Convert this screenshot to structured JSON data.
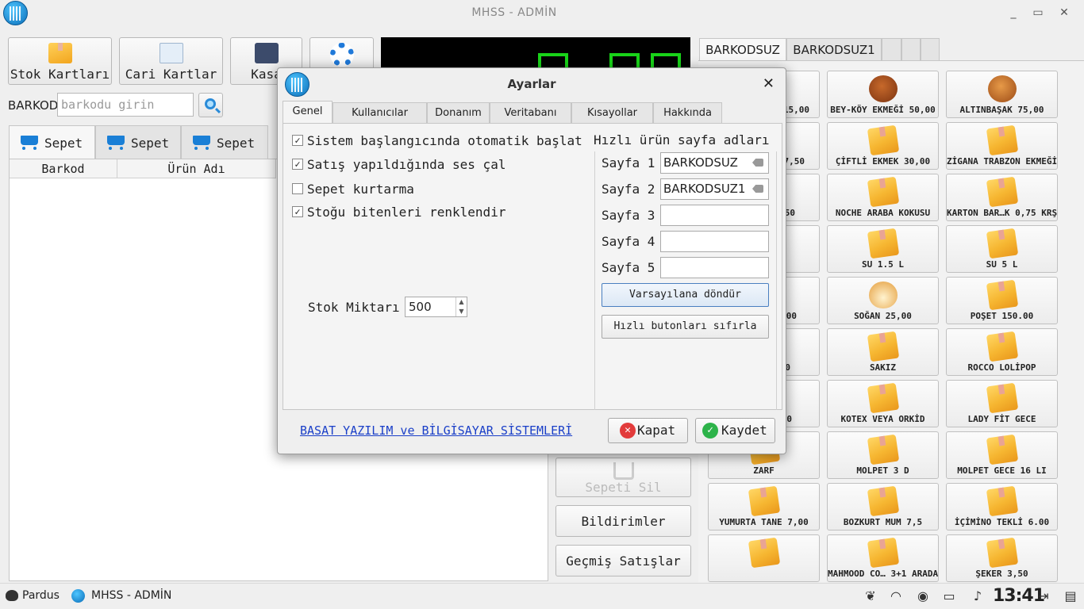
{
  "window": {
    "title": "MHSS - ADMİN"
  },
  "toolbar": {
    "stok_label": "Stok Kartları",
    "cari_label": "Cari Kartlar",
    "kasa_label": "Kasa"
  },
  "barcode": {
    "label": "BARKOD",
    "placeholder": "barkodu girin"
  },
  "cart_tabs": [
    "Sepet",
    "Sepet",
    "Sepet"
  ],
  "cart_table": {
    "columns": [
      "Barkod",
      "Ürün Adı"
    ]
  },
  "side_buttons": {
    "sepeti_sil": "Sepeti Sil",
    "bildirimler": "Bildirimler",
    "gecmis": "Geçmiş Satışlar"
  },
  "product_tabs": [
    "BARKODSUZ",
    "BARKODSUZ1"
  ],
  "products": {
    "col0": [
      "15,00",
      "7,50",
      "50",
      "",
      "00",
      "0",
      "00",
      "ZARF",
      "YUMURTA TANE 7,00",
      ""
    ],
    "col1": [
      "BEY-KÖY EKMEĞİ 50,00",
      "ÇİFTLİ EKMEK 30,00",
      "NOCHE ARABA KOKUSU",
      "SU 1.5 L",
      "SOĞAN 25,00",
      "SAKIZ",
      "KOTEX VEYA ORKİD",
      "MOLPET 3 D",
      "BOZKURT MUM 7,5",
      "MAHMOOD CO… 3+1 ARADA"
    ],
    "col2": [
      "ALTINBAŞAK 75,00",
      "ZİGANA TRABZON EKMEĞİ",
      "KARTON BAR…K 0,75 KRŞ",
      "SU 5 L",
      "POŞET 150.00",
      "ROCCO LOLİPOP",
      "LADY FİT GECE",
      "MOLPET GECE 16 LI",
      "İÇİMİNO TEKLİ 6.00",
      "ŞEKER 3,50"
    ]
  },
  "dialog": {
    "title": "Ayarlar",
    "tabs": [
      "Genel",
      "Kullanıcılar",
      "Donanım",
      "Veritabanı",
      "Kısayollar",
      "Hakkında"
    ],
    "options": {
      "auto_start": {
        "label": "Sistem başlangıcında otomatik başlat",
        "checked": true,
        "mark": "✓"
      },
      "sound": {
        "label": "Satış yapıldığında ses çal",
        "checked": true,
        "mark": "✓"
      },
      "recover": {
        "label": "Sepet kurtarma",
        "checked": false,
        "mark": ""
      },
      "color_out": {
        "label": "Stoğu bitenleri renklendir",
        "checked": true,
        "mark": "✓"
      }
    },
    "stock_label": "Stok Miktarı",
    "stock_value": "500",
    "pages_heading": "Hızlı ürün sayfa adları",
    "pages": [
      {
        "label": "Sayfa 1",
        "value": "BARKODSUZ"
      },
      {
        "label": "Sayfa 2",
        "value": "BARKODSUZ1"
      },
      {
        "label": "Sayfa 3",
        "value": ""
      },
      {
        "label": "Sayfa 4",
        "value": ""
      },
      {
        "label": "Sayfa 5",
        "value": ""
      }
    ],
    "reset_names_btn": "Varsayılana döndür",
    "reset_buttons_btn": "Hızlı butonları sıfırla",
    "company_link": "BASAT YAZILIM ve BİLGİSAYAR SİSTEMLERİ",
    "close_btn": "Kapat",
    "save_btn": "Kaydet"
  },
  "taskbar": {
    "start_label": "Pardus",
    "app_label": "MHSS - ADMİN",
    "clock": "13:41"
  },
  "colors": {
    "accent_blue": "#1a7fd6",
    "link": "#1a3fc8",
    "close_red": "#e23b3b",
    "save_green": "#2db34a",
    "display_green": "#19d319"
  }
}
